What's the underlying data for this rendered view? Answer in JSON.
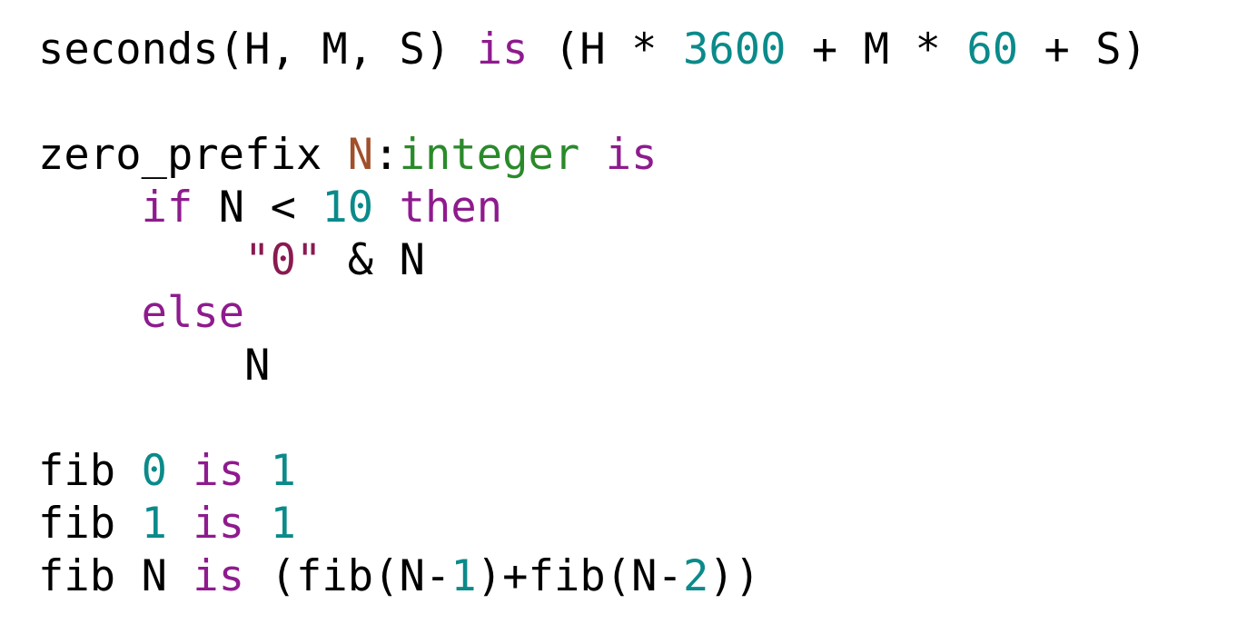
{
  "colors": {
    "plain": "#000000",
    "keyword": "#8e1b8e",
    "number": "#0b8a8a",
    "parameter": "#a0502a",
    "type": "#2a8a2a",
    "string": "#8a1a50"
  },
  "lines": [
    {
      "tokens": [
        {
          "text": "seconds(H, M, S) ",
          "kind": "plain"
        },
        {
          "text": "is",
          "kind": "keyword"
        },
        {
          "text": " (H * ",
          "kind": "plain"
        },
        {
          "text": "3600",
          "kind": "number"
        },
        {
          "text": " + M * ",
          "kind": "plain"
        },
        {
          "text": "60",
          "kind": "number"
        },
        {
          "text": " + S)",
          "kind": "plain"
        }
      ]
    },
    {
      "tokens": []
    },
    {
      "tokens": [
        {
          "text": "zero_prefix ",
          "kind": "plain"
        },
        {
          "text": "N",
          "kind": "parameter"
        },
        {
          "text": ":",
          "kind": "plain"
        },
        {
          "text": "integer",
          "kind": "type"
        },
        {
          "text": " ",
          "kind": "plain"
        },
        {
          "text": "is",
          "kind": "keyword"
        }
      ]
    },
    {
      "tokens": [
        {
          "text": "    ",
          "kind": "plain"
        },
        {
          "text": "if",
          "kind": "keyword"
        },
        {
          "text": " N < ",
          "kind": "plain"
        },
        {
          "text": "10",
          "kind": "number"
        },
        {
          "text": " ",
          "kind": "plain"
        },
        {
          "text": "then",
          "kind": "keyword"
        }
      ]
    },
    {
      "tokens": [
        {
          "text": "        ",
          "kind": "plain"
        },
        {
          "text": "\"0\"",
          "kind": "string"
        },
        {
          "text": " & N",
          "kind": "plain"
        }
      ]
    },
    {
      "tokens": [
        {
          "text": "    ",
          "kind": "plain"
        },
        {
          "text": "else",
          "kind": "keyword"
        }
      ]
    },
    {
      "tokens": [
        {
          "text": "        N",
          "kind": "plain"
        }
      ]
    },
    {
      "tokens": []
    },
    {
      "tokens": [
        {
          "text": "fib ",
          "kind": "plain"
        },
        {
          "text": "0",
          "kind": "number"
        },
        {
          "text": " ",
          "kind": "plain"
        },
        {
          "text": "is",
          "kind": "keyword"
        },
        {
          "text": " ",
          "kind": "plain"
        },
        {
          "text": "1",
          "kind": "number"
        }
      ]
    },
    {
      "tokens": [
        {
          "text": "fib ",
          "kind": "plain"
        },
        {
          "text": "1",
          "kind": "number"
        },
        {
          "text": " ",
          "kind": "plain"
        },
        {
          "text": "is",
          "kind": "keyword"
        },
        {
          "text": " ",
          "kind": "plain"
        },
        {
          "text": "1",
          "kind": "number"
        }
      ]
    },
    {
      "tokens": [
        {
          "text": "fib N ",
          "kind": "plain"
        },
        {
          "text": "is",
          "kind": "keyword"
        },
        {
          "text": " (fib(N-",
          "kind": "plain"
        },
        {
          "text": "1",
          "kind": "number"
        },
        {
          "text": ")+fib(N-",
          "kind": "plain"
        },
        {
          "text": "2",
          "kind": "number"
        },
        {
          "text": "))",
          "kind": "plain"
        }
      ]
    }
  ]
}
